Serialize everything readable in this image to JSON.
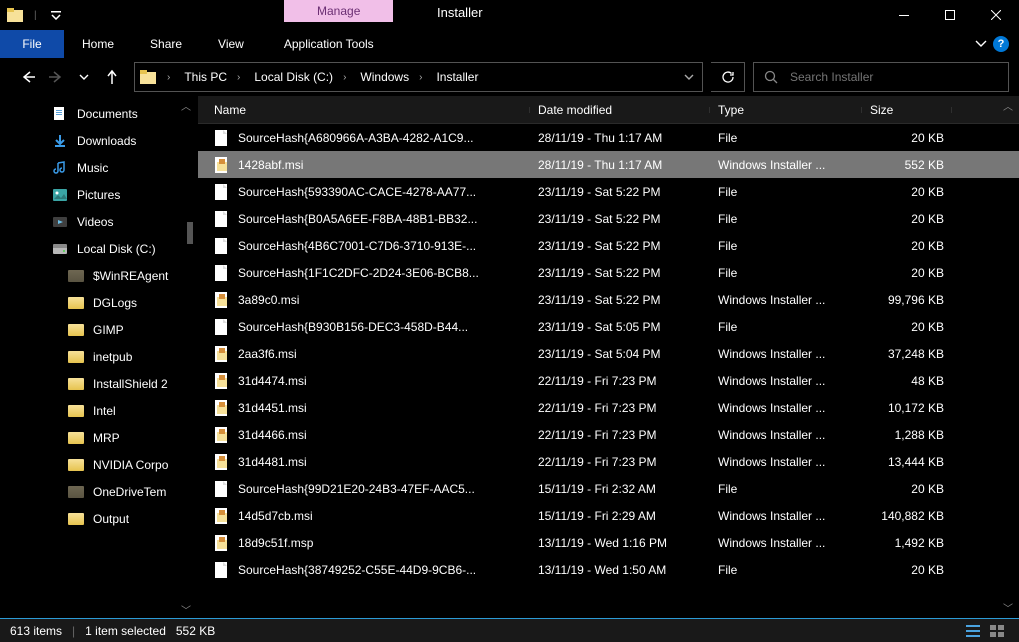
{
  "window": {
    "title": "Installer",
    "context_tab": "Manage",
    "ribbon_tab": "Application Tools"
  },
  "menu": {
    "file": "File",
    "home": "Home",
    "share": "Share",
    "view": "View"
  },
  "breadcrumb": {
    "root": "This PC",
    "drive": "Local Disk (C:)",
    "folder1": "Windows",
    "folder2": "Installer"
  },
  "search": {
    "placeholder": "Search Installer"
  },
  "sidebar": {
    "items": [
      {
        "label": "Documents",
        "icon": "documents"
      },
      {
        "label": "Downloads",
        "icon": "downloads"
      },
      {
        "label": "Music",
        "icon": "music"
      },
      {
        "label": "Pictures",
        "icon": "pictures"
      },
      {
        "label": "Videos",
        "icon": "videos"
      },
      {
        "label": "Local Disk (C:)",
        "icon": "drive"
      }
    ],
    "subitems": [
      {
        "label": "$WinREAgent"
      },
      {
        "label": "DGLogs"
      },
      {
        "label": "GIMP"
      },
      {
        "label": "inetpub"
      },
      {
        "label": "InstallShield 2"
      },
      {
        "label": "Intel"
      },
      {
        "label": "MRP"
      },
      {
        "label": "NVIDIA Corpo"
      },
      {
        "label": "OneDriveTem"
      },
      {
        "label": "Output"
      }
    ]
  },
  "columns": {
    "name": "Name",
    "date": "Date modified",
    "type": "Type",
    "size": "Size"
  },
  "files": [
    {
      "name": "SourceHash{A680966A-A3BA-4282-A1C9...",
      "date": "28/11/19 - Thu 1:17 AM",
      "type": "File",
      "size": "20 KB",
      "icon": "generic"
    },
    {
      "name": "1428abf.msi",
      "date": "28/11/19 - Thu 1:17 AM",
      "type": "Windows Installer ...",
      "size": "552 KB",
      "icon": "msi",
      "selected": true
    },
    {
      "name": "SourceHash{593390AC-CACE-4278-AA77...",
      "date": "23/11/19 - Sat 5:22 PM",
      "type": "File",
      "size": "20 KB",
      "icon": "generic"
    },
    {
      "name": "SourceHash{B0A5A6EE-F8BA-48B1-BB32...",
      "date": "23/11/19 - Sat 5:22 PM",
      "type": "File",
      "size": "20 KB",
      "icon": "generic"
    },
    {
      "name": "SourceHash{4B6C7001-C7D6-3710-913E-...",
      "date": "23/11/19 - Sat 5:22 PM",
      "type": "File",
      "size": "20 KB",
      "icon": "generic"
    },
    {
      "name": "SourceHash{1F1C2DFC-2D24-3E06-BCB8...",
      "date": "23/11/19 - Sat 5:22 PM",
      "type": "File",
      "size": "20 KB",
      "icon": "generic"
    },
    {
      "name": "3a89c0.msi",
      "date": "23/11/19 - Sat 5:22 PM",
      "type": "Windows Installer ...",
      "size": "99,796 KB",
      "icon": "msi"
    },
    {
      "name": "SourceHash{B930B156-DEC3-458D-B44...",
      "date": "23/11/19 - Sat 5:05 PM",
      "type": "File",
      "size": "20 KB",
      "icon": "generic"
    },
    {
      "name": "2aa3f6.msi",
      "date": "23/11/19 - Sat 5:04 PM",
      "type": "Windows Installer ...",
      "size": "37,248 KB",
      "icon": "msi"
    },
    {
      "name": "31d4474.msi",
      "date": "22/11/19 - Fri 7:23 PM",
      "type": "Windows Installer ...",
      "size": "48 KB",
      "icon": "msi"
    },
    {
      "name": "31d4451.msi",
      "date": "22/11/19 - Fri 7:23 PM",
      "type": "Windows Installer ...",
      "size": "10,172 KB",
      "icon": "msi"
    },
    {
      "name": "31d4466.msi",
      "date": "22/11/19 - Fri 7:23 PM",
      "type": "Windows Installer ...",
      "size": "1,288 KB",
      "icon": "msi"
    },
    {
      "name": "31d4481.msi",
      "date": "22/11/19 - Fri 7:23 PM",
      "type": "Windows Installer ...",
      "size": "13,444 KB",
      "icon": "msi"
    },
    {
      "name": "SourceHash{99D21E20-24B3-47EF-AAC5...",
      "date": "15/11/19 - Fri 2:32 AM",
      "type": "File",
      "size": "20 KB",
      "icon": "generic"
    },
    {
      "name": "14d5d7cb.msi",
      "date": "15/11/19 - Fri 2:29 AM",
      "type": "Windows Installer ...",
      "size": "140,882 KB",
      "icon": "msi"
    },
    {
      "name": "18d9c51f.msp",
      "date": "13/11/19 - Wed 1:16 PM",
      "type": "Windows Installer ...",
      "size": "1,492 KB",
      "icon": "msi"
    },
    {
      "name": "SourceHash{38749252-C55E-44D9-9CB6-...",
      "date": "13/11/19 - Wed 1:50 AM",
      "type": "File",
      "size": "20 KB",
      "icon": "generic"
    }
  ],
  "status": {
    "count": "613 items",
    "selection": "1 item selected",
    "size": "552 KB"
  }
}
